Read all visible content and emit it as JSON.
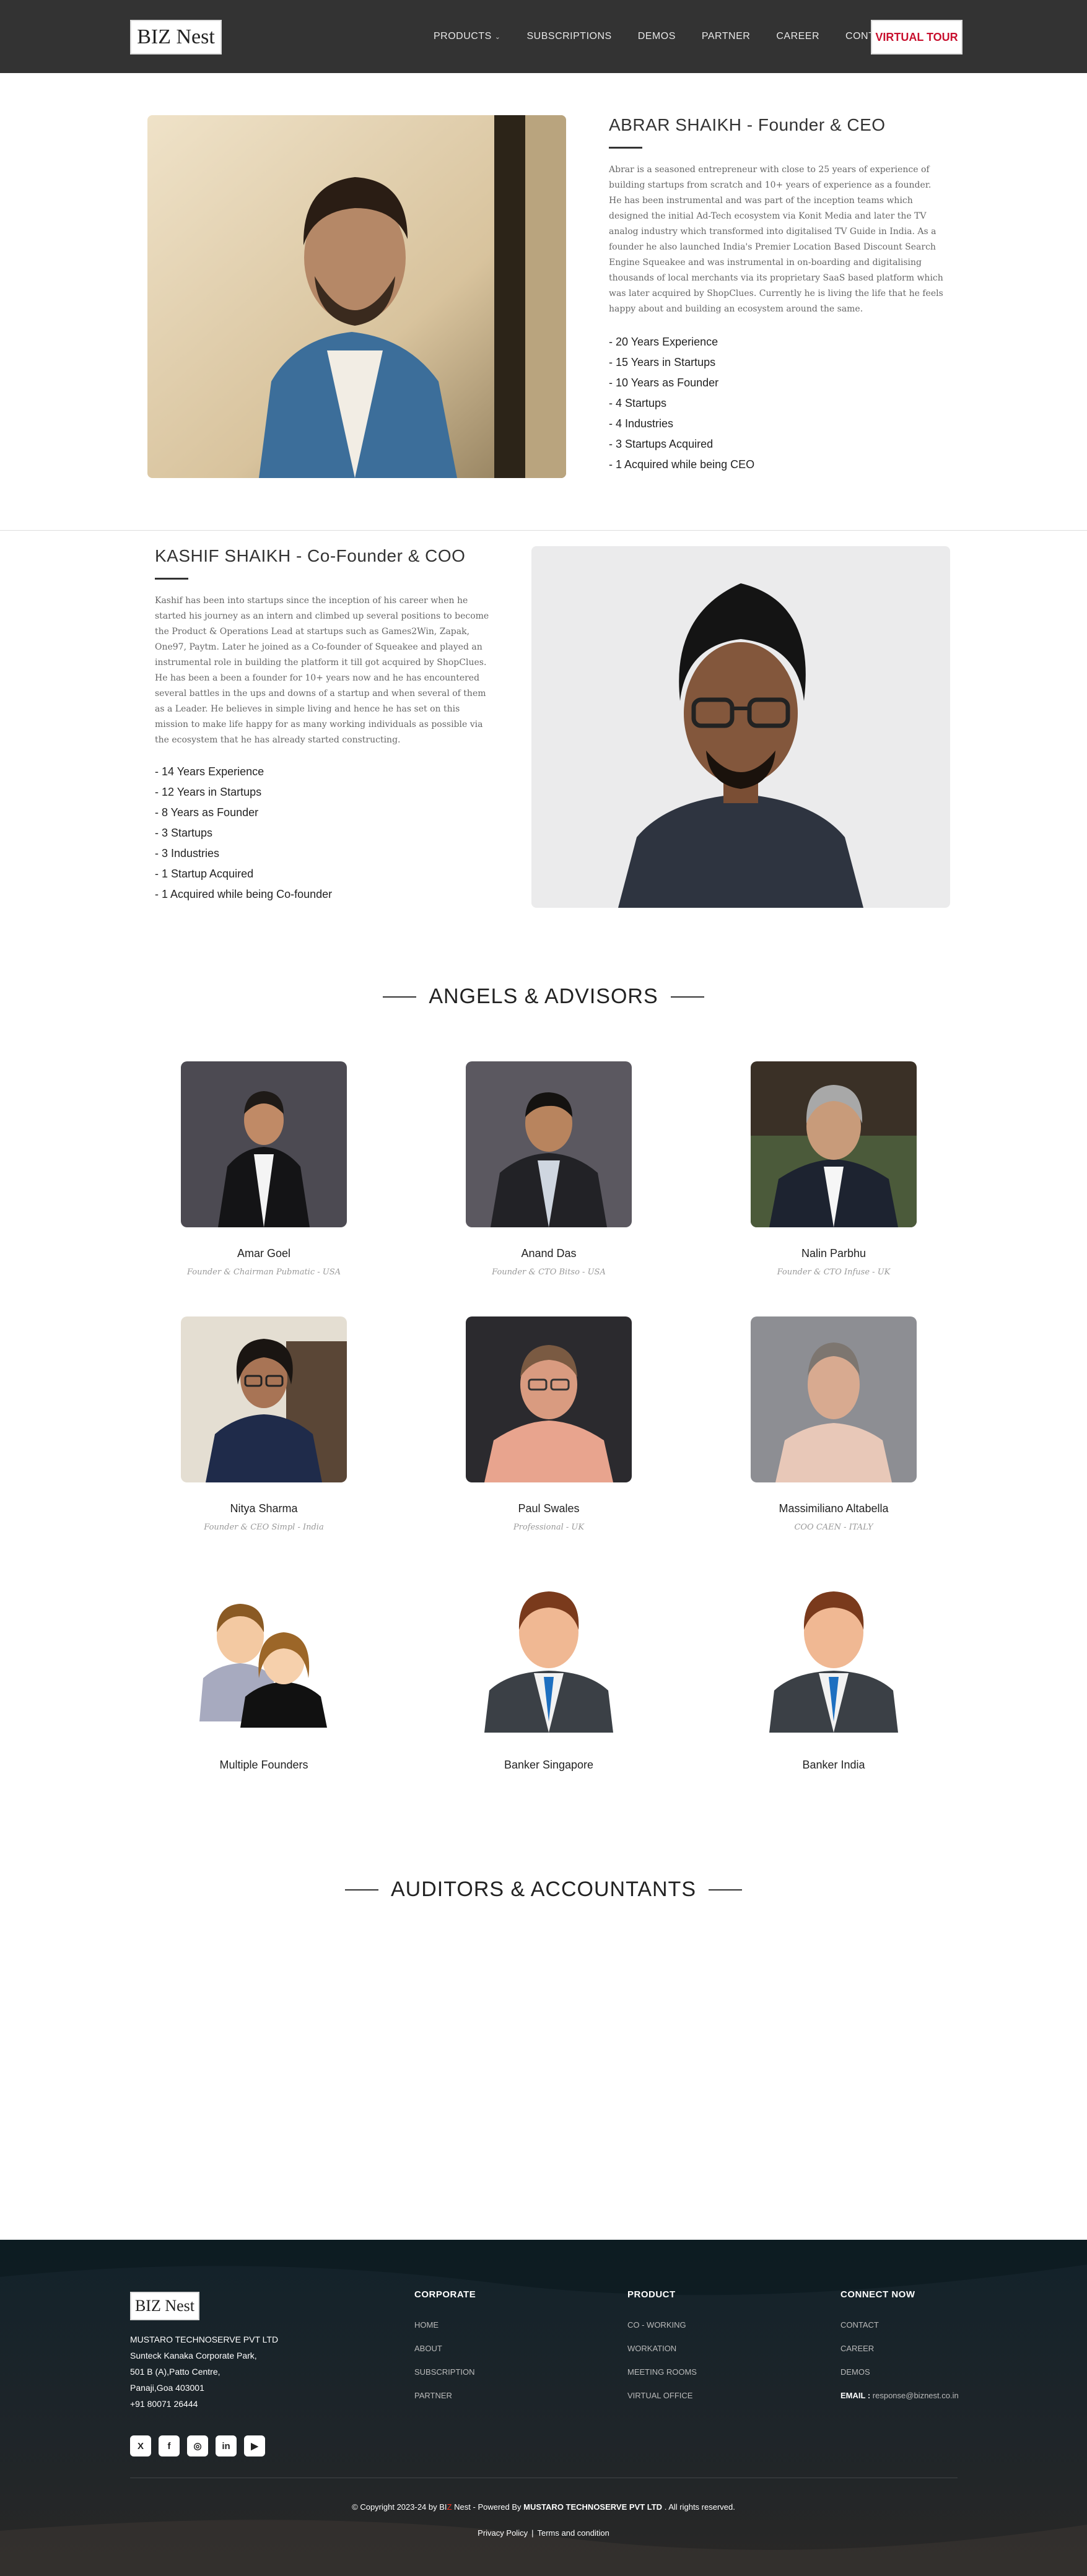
{
  "header": {
    "logo": {
      "prefix": "BIZ",
      "suffix": "Nest"
    },
    "nav": [
      {
        "label": "PRODUCTS",
        "has_dropdown": true
      },
      {
        "label": "SUBSCRIPTIONS"
      },
      {
        "label": "DEMOS"
      },
      {
        "label": "PARTNER"
      },
      {
        "label": "CAREER"
      },
      {
        "label": "CONTACT"
      }
    ],
    "cta": "VIRTUAL TOUR"
  },
  "founders": [
    {
      "name": "ABRAR SHAIKH - Founder & CEO",
      "bio": "Abrar is a seasoned entrepreneur with close to 25 years of experience of building startups from scratch and 10+ years of experience as a founder. He has been instrumental and was part of the inception teams which designed the initial Ad-Tech ecosystem via Konit Media and later the TV analog industry which transformed into digitalised TV Guide in India. As a founder he also launched India's Premier Location Based Discount Search Engine Squeakee and was instrumental in on-boarding and digitalising thousands of local merchants via its proprietary SaaS based platform which was later acquired by ShopClues. Currently he is living the life that he feels happy about and building an ecosystem around the same.",
      "stats": [
        "- 20 Years Experience",
        "- 15 Years in Startups",
        "- 10 Years as Founder",
        "- 4 Startups",
        "- 4 Industries",
        "- 3 Startups Acquired",
        "- 1 Acquired while being CEO"
      ]
    },
    {
      "name": "KASHIF SHAIKH - Co-Founder & COO",
      "bio": "Kashif has been into startups since the inception of his career when he started his journey as an intern and climbed up several positions to become the Product & Operations Lead at startups such as Games2Win, Zapak, One97, Paytm. Later he joined as a Co-founder of Squeakee and played an instrumental role in building the platform it till got acquired by ShopClues. He has been a been a founder for 10+ years now and he has encountered several battles in the ups and downs of a startup and when several of them as a Leader. He believes in simple living and hence he has set on this mission to make life happy for as many working individuals as possible via the ecosystem that he has already started constructing.",
      "stats": [
        "- 14 Years Experience",
        "- 12 Years in Startups",
        "- 8 Years as Founder",
        "- 3 Startups",
        "- 3 Industries",
        "- 1 Startup Acquired",
        "- 1 Acquired while being Co-founder"
      ]
    }
  ],
  "advisors_title": "ANGELS & ADVISORS",
  "advisors": [
    {
      "name": "Amar Goel",
      "role": "Founder & Chairman Pubmatic - USA"
    },
    {
      "name": "Anand Das",
      "role": "Founder & CTO Bitso - USA"
    },
    {
      "name": "Nalin Parbhu",
      "role": "Founder & CTO Infuse - UK"
    },
    {
      "name": "Nitya Sharma",
      "role": "Founder & CEO Simpl - India"
    },
    {
      "name": "Paul Swales",
      "role": "Professional - UK"
    },
    {
      "name": "Massimiliano Altabella",
      "role": "COO CAEN - ITALY"
    },
    {
      "name": "Multiple Founders",
      "role": ""
    },
    {
      "name": "Banker Singapore",
      "role": ""
    },
    {
      "name": "Banker India",
      "role": ""
    }
  ],
  "auditors_title": "AUDITORS & ACCOUNTANTS",
  "footer": {
    "address": [
      "MUSTARO TECHNOSERVE PVT LTD",
      "Sunteck Kanaka Corporate Park,",
      "501 B (A),Patto Centre,",
      "Panaji,Goa 403001",
      "+91 80071 26444"
    ],
    "corporate": {
      "title": "CORPORATE",
      "links": [
        "HOME",
        "ABOUT",
        "SUBSCRIPTION",
        "PARTNER"
      ]
    },
    "product": {
      "title": "PRODUCT",
      "links": [
        "CO - WORKING",
        "WORKATION",
        "MEETING ROOMS",
        "VIRTUAL OFFICE"
      ]
    },
    "connect": {
      "title": "CONNECT NOW",
      "links": [
        "CONTACT",
        "CAREER",
        "DEMOS"
      ],
      "email_label": "EMAIL :",
      "email": "response@biznest.co.in"
    },
    "social": [
      "X",
      "f",
      "◎",
      "in",
      "▶"
    ],
    "copyright": {
      "pre": "© Copyright 2023-24 by",
      "brand_a": "BI",
      "brand_b": "Z",
      "brand_c": "Nest",
      "mid": "- Powered By",
      "company": "MUSTARO TECHNOSERVE PVT LTD",
      "post": ". All rights reserved."
    },
    "policy": "Privacy Policy",
    "terms": "Terms and condition"
  },
  "colors": {
    "header_bg": "#333333",
    "accent": "#c8102e",
    "footer_bg": "#1c2226"
  }
}
